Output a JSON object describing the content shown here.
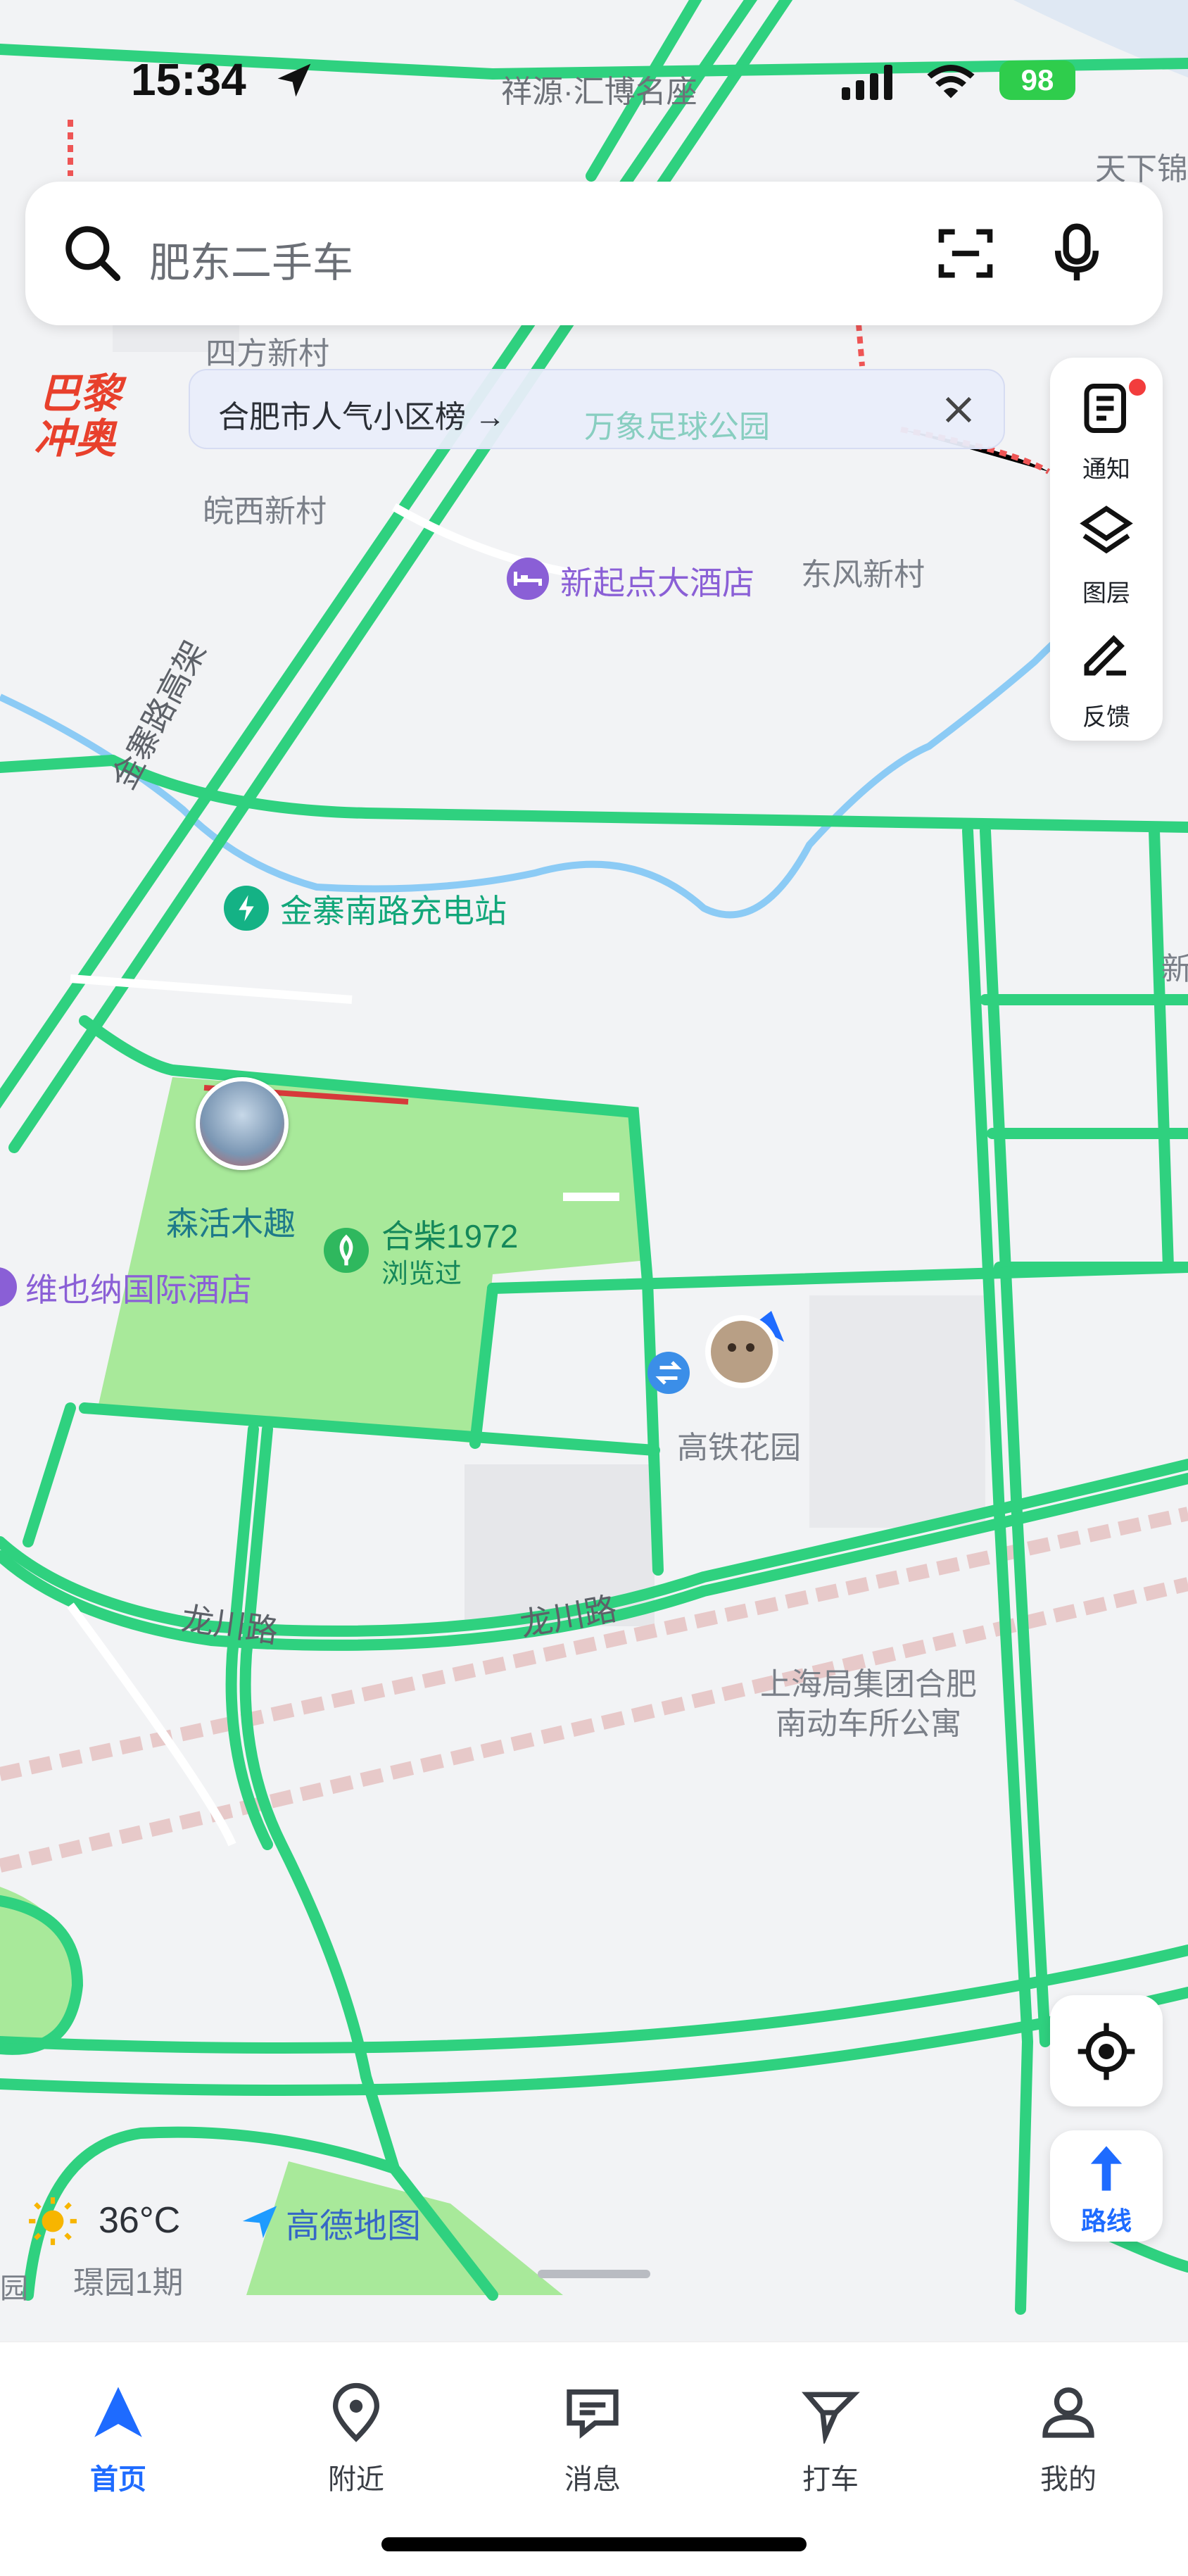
{
  "status_bar": {
    "time": "15:34",
    "top_place": "祥源·汇博名座",
    "battery": "98"
  },
  "search": {
    "placeholder": "肥东二手车"
  },
  "banner": {
    "text": "合肥市人气小区榜 →",
    "behind_label": "万象足球公园"
  },
  "badge": {
    "line1": "巴黎",
    "line2": "冲奥"
  },
  "side_panel": {
    "notify": "通知",
    "layers": "图层",
    "feedback": "反馈"
  },
  "map_labels": {
    "tianxia": "天下锦",
    "sifang": "四方新村",
    "wanxi": "皖西新村",
    "dongfeng": "东风新村",
    "hotel_xinqidian": "新起点大酒店",
    "jinzhai_road": "金寨路高架",
    "charging": "金寨南路充电站",
    "senhuo": "森活木趣",
    "hechai": "合柴1972",
    "hechai_sub": "浏览过",
    "weiyena": "维也纳国际酒店",
    "gaotie": "高铁花园",
    "longchuan1": "龙川路",
    "longchuan2": "龙川路",
    "shanghai_ju": "上海局集团合肥",
    "shanghai_ju2": "南动车所公寓",
    "xinfu": "新",
    "jingyuan": "璟园1期",
    "yuan_edge": "园"
  },
  "weather": {
    "temp": "36°C",
    "brand": "高德地图"
  },
  "route_button": {
    "label": "路线"
  },
  "tabs": [
    {
      "label": "首页",
      "icon": "navigation-arrow-icon",
      "active": true
    },
    {
      "label": "附近",
      "icon": "location-pin-icon",
      "active": false
    },
    {
      "label": "消息",
      "icon": "message-icon",
      "active": false
    },
    {
      "label": "打车",
      "icon": "taxi-flag-icon",
      "active": false
    },
    {
      "label": "我的",
      "icon": "user-icon",
      "active": false
    }
  ],
  "colors": {
    "road_green": "#2fd17f",
    "park_green": "#a8e99a",
    "water": "#8ccbf5",
    "accent_blue": "#1e6bff"
  }
}
